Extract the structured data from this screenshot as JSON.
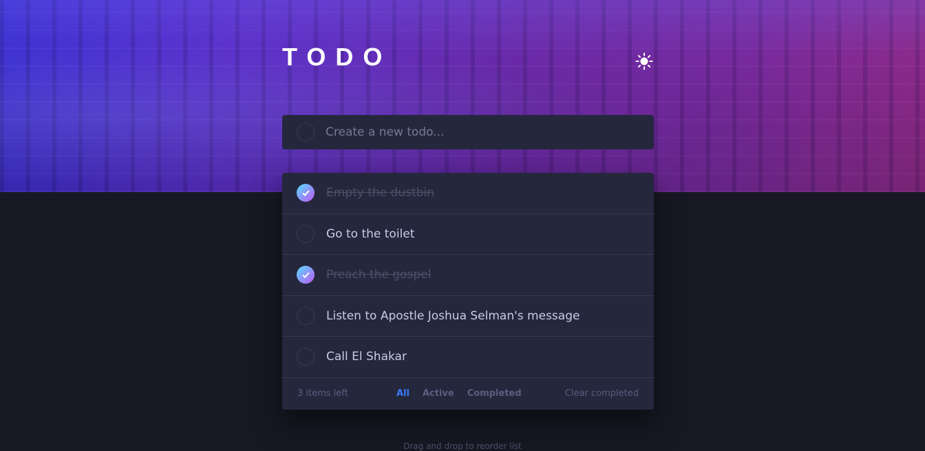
{
  "header": {
    "title": "TODO",
    "theme_toggle_icon": "sun-icon"
  },
  "create": {
    "placeholder": "Create a new todo..."
  },
  "todos": [
    {
      "text": "Empty the dustbin",
      "completed": true
    },
    {
      "text": "Go to the toilet",
      "completed": false
    },
    {
      "text": "Preach the gospel",
      "completed": true
    },
    {
      "text": "Listen to Apostle Joshua Selman's message",
      "completed": false
    },
    {
      "text": "Call El Shakar",
      "completed": false
    }
  ],
  "footer": {
    "items_left": "3 items left",
    "filters": [
      "All",
      "Active",
      "Completed"
    ],
    "active_filter": "All",
    "clear_label": "Clear completed"
  },
  "hint": "Drag and drop to reorder list",
  "colors": {
    "accent": "#3a7cfd",
    "check_gradient_start": "#55ddff",
    "check_gradient_end": "#c058f3",
    "card": "#25273d",
    "background": "#171823"
  }
}
